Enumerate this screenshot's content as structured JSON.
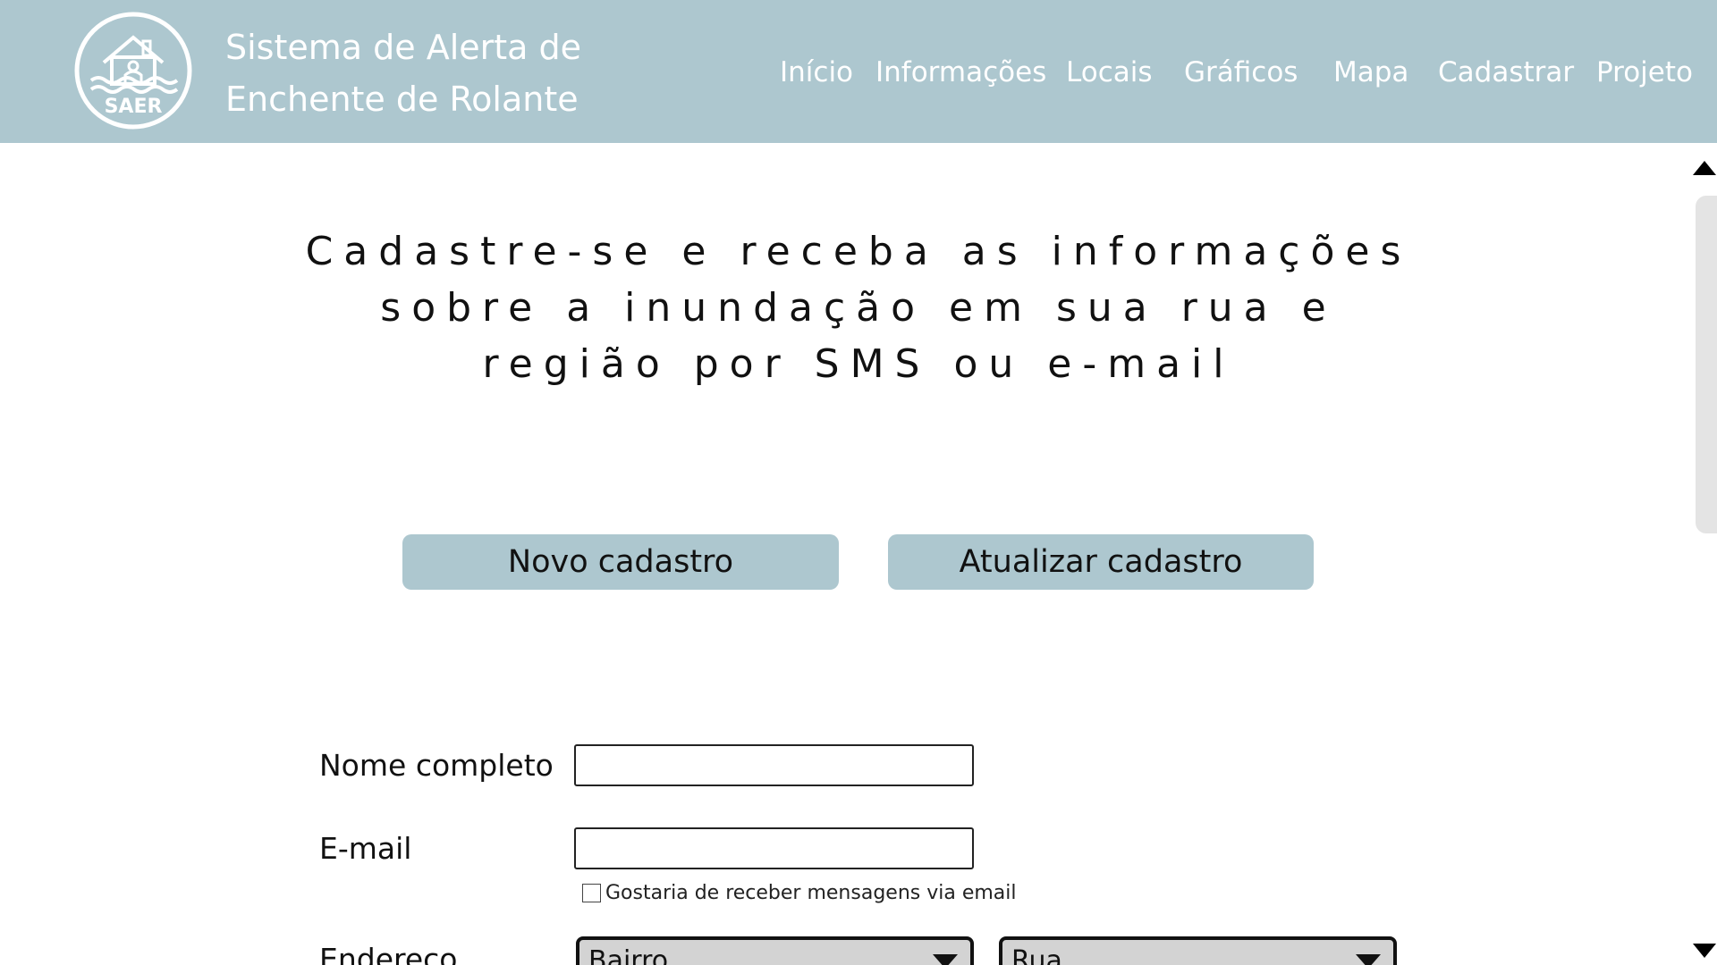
{
  "header": {
    "logo_text": "SAER",
    "title_line1": "Sistema de Alerta de",
    "title_line2": "Enchente de Rolante",
    "nav": [
      {
        "label": "Início"
      },
      {
        "label": "Informações"
      },
      {
        "label": "Locais"
      },
      {
        "label": "Gráficos"
      },
      {
        "label": "Mapa"
      },
      {
        "label": "Cadastrar"
      },
      {
        "label": "Projeto"
      }
    ]
  },
  "main": {
    "headline": [
      "Cadastre-se e receba as informações",
      "sobre a inundação em sua rua e",
      "região por SMS ou e-mail"
    ],
    "buttons": {
      "new": "Novo cadastro",
      "update": "Atualizar cadastro"
    }
  },
  "form": {
    "name": {
      "label": "Nome completo",
      "value": ""
    },
    "email": {
      "label": "E-mail",
      "value": ""
    },
    "email_opt_in": {
      "label": "Gostaria de receber mensagens via email",
      "checked": false
    },
    "address": {
      "label": "Endereço",
      "bairro": "Bairro",
      "rua": "Rua"
    }
  },
  "colors": {
    "header_bg": "#adc7cf",
    "button_bg": "#adc7cf",
    "select_bg": "#d3d3d3"
  }
}
